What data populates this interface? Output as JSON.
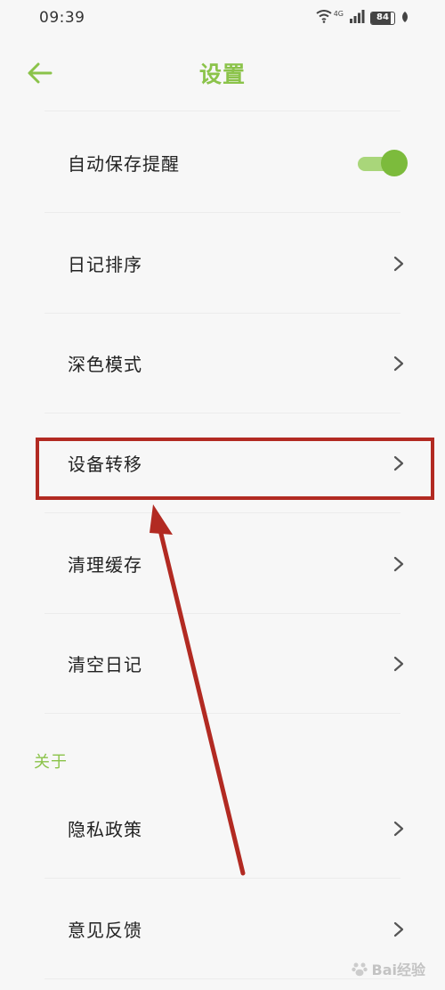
{
  "status_bar": {
    "time": "09:39",
    "network": "4G",
    "battery": "84",
    "battery_level": 0.84
  },
  "header": {
    "title": "设置"
  },
  "settings": {
    "items": [
      {
        "label": "自动保存提醒",
        "control": "toggle",
        "on": true
      },
      {
        "label": "日记排序",
        "control": "chevron"
      },
      {
        "label": "深色模式",
        "control": "chevron"
      },
      {
        "label": "设备转移",
        "control": "chevron"
      },
      {
        "label": "清理缓存",
        "control": "chevron"
      },
      {
        "label": "清空日记",
        "control": "chevron"
      }
    ]
  },
  "about": {
    "section_title": "关于",
    "items": [
      {
        "label": "隐私政策",
        "control": "chevron"
      },
      {
        "label": "意见反馈",
        "control": "chevron"
      }
    ]
  },
  "watermark": {
    "text": "Bai经验"
  },
  "colors": {
    "accent": "#8bc34a",
    "toggle_knob": "#7cbb3c",
    "toggle_track": "#a9d67a",
    "annotation": "#b22a22",
    "background": "#f7f7f7"
  },
  "icons": {
    "back": "arrow-left-icon",
    "chevron": "chevron-right-icon",
    "wifi": "wifi-icon",
    "signal": "signal-icon",
    "battery": "battery-icon",
    "leaf": "leaf-icon"
  }
}
